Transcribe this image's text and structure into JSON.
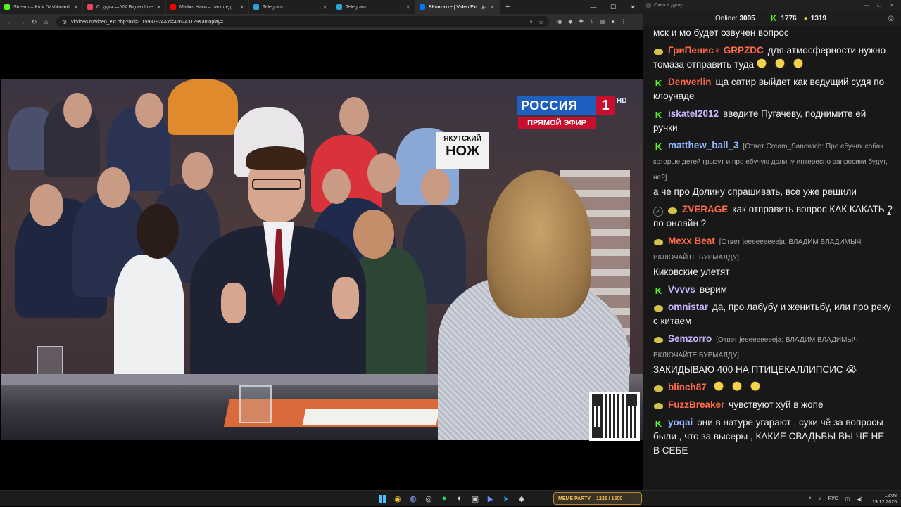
{
  "browser": {
    "tabs": [
      {
        "label": "Stream – Kick Dashboard",
        "color": "#53fc18",
        "active": false
      },
      {
        "label": "Студия — VK Видео Live",
        "color": "#e8455a",
        "active": false
      },
      {
        "label": "Майкл Наки – расследования",
        "color": "#ff0000",
        "active": false
      },
      {
        "label": "Telegram",
        "color": "#2aa3e0",
        "active": false
      },
      {
        "label": "Telegram",
        "color": "#2aa3e0",
        "active": false
      },
      {
        "label": "ВКонтакте | Video Ext",
        "color": "#0077ff",
        "active": true
      }
    ],
    "url": "vkvideo.ru/video_ext.php?oid=-115987924&id=456243129&autoplay=1"
  },
  "video": {
    "channel_name": "РОССИЯ",
    "channel_number": "1",
    "hd": "HD",
    "live_label": "ПРЯМОЙ ЭФИР",
    "sign_top": "ЯКУТСКИЙ",
    "sign_big": "НОЖ"
  },
  "chat": {
    "window_title": "Окно в душу",
    "online_label": "Online:",
    "online_count": "3095",
    "kick_count": "1776",
    "coin_count": "1319",
    "messages": [
      {
        "badge": "none",
        "user": "",
        "user_color": "#efefef",
        "reply": "",
        "text": "мск и мо будет озвучен вопрос",
        "emotes": 0
      },
      {
        "badge": "s",
        "user": "ГриПенис♀ GRPZDC",
        "user_color": "#ff6a4a",
        "reply": "",
        "text": "для атмосферности нужно томаза отправить туда",
        "emotes": 3
      },
      {
        "badge": "k",
        "user": "Denverlin",
        "user_color": "#ff6a4a",
        "reply": "",
        "text": "ща сатир выйдет как ведущий судя по клоунаде",
        "emotes": 0
      },
      {
        "badge": "k",
        "user": "iskatel2012",
        "user_color": "#c9b6ff",
        "reply": "",
        "text": "введите Пугачеву, поднимите ей ручки",
        "emotes": 0
      },
      {
        "badge": "k",
        "user": "matthew_ball_3",
        "user_color": "#8fb9ff",
        "reply": "[Ответ Cream_Sandwich: Про ебучих собак которые детей грызут и про ебучую долину интересно вапросики будут, не?]",
        "text": "а че про Долину спрашивать, все уже решили",
        "emotes": 0
      },
      {
        "badge": "vs",
        "user": "ZVERAGE",
        "user_color": "#ff6a4a",
        "reply": "",
        "text": "как отправить вопрос КАК КАКАТЬ ? по онлайн ?",
        "emotes": 0
      },
      {
        "badge": "s",
        "user": "Mexx Beat",
        "user_color": "#ff6a4a",
        "reply": "[Ответ jeeeeeeeeeja: ВЛАДИМ ВЛАДИМЫЧ ВКЛЮЧАЙТЕ БУРМАЛДУ]",
        "text": "Киковские улетят",
        "emotes": 0
      },
      {
        "badge": "k",
        "user": "Vvvvs",
        "user_color": "#c9b6ff",
        "reply": "",
        "text": "верим",
        "emotes": 0
      },
      {
        "badge": "s",
        "user": "omnistar",
        "user_color": "#c9b6ff",
        "reply": "",
        "text": "да, про лабубу и женитьбу, или про реку с китаем",
        "emotes": 0
      },
      {
        "badge": "s",
        "user": "Semzorro",
        "user_color": "#c9b6ff",
        "reply": "[Ответ jeeeeeeeeeja: ВЛАДИМ ВЛАДИМЫЧ ВКЛЮЧАЙТЕ БУРМАЛДУ]",
        "text": "ЗАКИДЫВАЮ 400 НА ПТИЦЕКАЛЛИПСИС 😭",
        "emotes": 0
      },
      {
        "badge": "s",
        "user": "blinch87",
        "user_color": "#ff6a4a",
        "reply": "",
        "text": "",
        "emotes": 3
      },
      {
        "badge": "s",
        "user": "FuzzBreaker",
        "user_color": "#ff6a4a",
        "reply": "",
        "text": "чувствуют хуй в жопе",
        "emotes": 0
      },
      {
        "badge": "k",
        "user": "yoqai",
        "user_color": "#8fb9ff",
        "reply": "",
        "text": "они в натуре угарают , суки чё за вопросы были , что за высеры , КАКИЕ СВАДЬБЫ ВЫ ЧЕ НЕ В СЕБЕ",
        "emotes": 0
      }
    ]
  },
  "taskbar": {
    "widget_label": "MEME PARTY",
    "widget_value": "1225 / 1500",
    "lang": "РУС",
    "time": "12:08",
    "date": "19.12.2025"
  }
}
